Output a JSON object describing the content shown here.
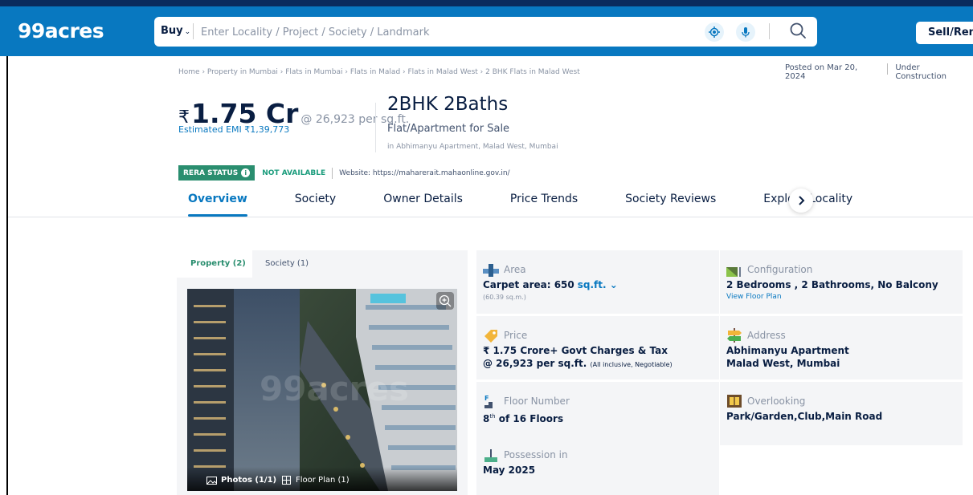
{
  "header": {
    "logo": "99acres",
    "buy_label": "Buy",
    "search_placeholder": "Enter Locality / Project / Society / Landmark",
    "sell_rent_label": "Sell/Rent"
  },
  "breadcrumb": "Home › Property in Mumbai › Flats in Mumbai › Flats in Malad › Flats in Malad West › 2 BHK Flats in Malad West",
  "posted": {
    "date": "Posted on Mar 20, 2024",
    "status": "Under Construction"
  },
  "listing": {
    "currency": "₹",
    "price": "1.75 Cr",
    "rate": "@ 26,923 per sq.ft.",
    "emi": "Estimated EMI ₹1,39,773",
    "title": "2BHK 2Baths",
    "type": "Flat/Apartment for Sale",
    "location": "in Abhimanyu Apartment, Malad West, Mumbai"
  },
  "rera": {
    "badge": "RERA STATUS",
    "status": "NOT AVAILABLE",
    "website": "Website: https://maharerait.mahaonline.gov.in/"
  },
  "tabs": [
    "Overview",
    "Society",
    "Owner Details",
    "Price Trends",
    "Society Reviews",
    "Explore Locality"
  ],
  "gallery": {
    "tabs": [
      "Property (2)",
      "Society (1)"
    ],
    "watermark": "99acres",
    "photos_label": "Photos (1/1)",
    "floorplan_label": "Floor Plan (1)"
  },
  "details": {
    "area": {
      "label": "Area",
      "value": "Carpet area: 650",
      "unit": "sq.ft.",
      "sub": "(60.39 sq.m.)"
    },
    "configuration": {
      "label": "Configuration",
      "value": "2 Bedrooms , 2 Bathrooms, No Balcony",
      "link": "View Floor Plan"
    },
    "price": {
      "label": "Price",
      "value1": "₹ 1.75 Crore+ Govt Charges & Tax",
      "value2": "@ 26,923 per sq.ft.",
      "note": "(All inclusive, Negotiable)"
    },
    "address": {
      "label": "Address",
      "line1": "Abhimanyu Apartment",
      "line2": "Malad West, Mumbai"
    },
    "floor": {
      "label": "Floor Number",
      "floor_num": "8",
      "sup": "th",
      "rest": " of 16 Floors"
    },
    "overlooking": {
      "label": "Overlooking",
      "value": "Park/Garden,Club,Main Road"
    },
    "possession": {
      "label": "Possession in",
      "value": "May 2025"
    }
  },
  "colors": {
    "brand_blue": "#0878c0",
    "rera_green": "#2a8e6f"
  }
}
